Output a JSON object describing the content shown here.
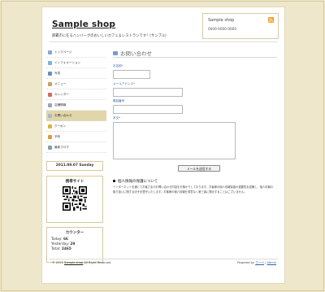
{
  "header": {
    "shop_title": "Sample shop",
    "tagline": "那覇市に在るハンバーグのおいしいカフェ＆レストランです！(サンプル)",
    "box_title": "Sample shop",
    "box_phone": "0000-0000-0000"
  },
  "nav": {
    "items": [
      {
        "label": "トップページ",
        "icon": "home-icon",
        "color": "#8aa7d6"
      },
      {
        "label": "インフォメーション",
        "icon": "info-icon",
        "color": "#7fb0d8"
      },
      {
        "label": "写真",
        "icon": "photo-icon",
        "color": "#6b8fb5"
      },
      {
        "label": "メニュー",
        "icon": "menu-icon",
        "color": "#c9a25c"
      },
      {
        "label": "カレンダー",
        "icon": "calendar-icon",
        "color": "#d16a5a"
      },
      {
        "label": "店舗情報",
        "icon": "store-icon",
        "color": "#9aa5b0"
      },
      {
        "label": "お問い合わせ",
        "icon": "mail-icon",
        "color": "#a9b8c9"
      },
      {
        "label": "クーポン",
        "icon": "coupon-icon",
        "color": "#e0b341"
      },
      {
        "label": "予約",
        "icon": "reserve-icon",
        "color": "#e09a3a"
      },
      {
        "label": "最新ブログ",
        "icon": "blog-icon",
        "color": "#8d9aa6"
      }
    ],
    "active_index": 6
  },
  "widgets": {
    "date": "2011.08.07 Sunday",
    "mobile_heading": "携帯サイト",
    "counter_heading": "カウンター",
    "today_label": "Today:",
    "today_value": "66",
    "yesterday_label": "Yesterday:",
    "yesterday_value": "29",
    "total_label": "Total:",
    "total_value": "2465"
  },
  "main": {
    "title": "お問い合わせ",
    "name_label": "お名前*",
    "email_label": "メールアドレス*",
    "phone_label": "電話番号",
    "body_label": "本文*",
    "submit_label": "メールを送信する",
    "privacy_heading": "個人情報の保護について",
    "privacy_text": "インターネットを通じてお客さまのお問い合わせ内容をお預かりしております。お客様の個人情報保護の重要性を認識し、個人情報の取り扱いに関する法令を遵守いたします。お客様の個人情報を同意なく第三者に開示することはございません。"
  },
  "footer": {
    "copyright_prefix": "© 2011",
    "copyright_link": "Sample shop",
    "copyright_suffix": "All Right Reserved",
    "powered_prefix": "Powered by",
    "powered_link": "グーペ",
    "separator": "/",
    "admin_link": "Admin"
  },
  "colors": {
    "background": "#efe7cc",
    "accent_border": "#d9c98f",
    "active_nav": "#e0d6a9",
    "link_blue": "#2f5fa7"
  }
}
